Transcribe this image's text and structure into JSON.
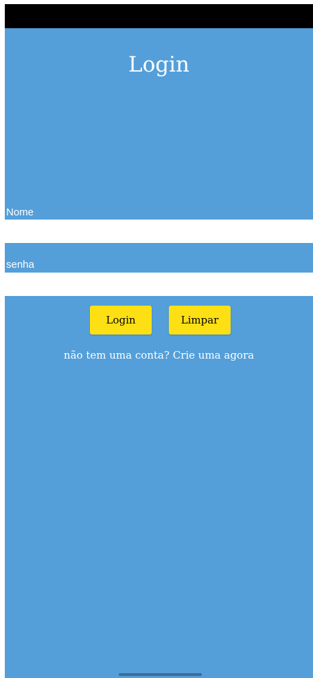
{
  "header": {
    "title": "Login"
  },
  "form": {
    "nome_label": "Nome",
    "nome_value": "",
    "senha_label": "senha",
    "senha_value": ""
  },
  "buttons": {
    "login_label": "Login",
    "limpar_label": "Limpar"
  },
  "signup": {
    "text": "não tem uma conta? Crie uma agora"
  },
  "colors": {
    "background": "#549fd9",
    "button": "#fde013",
    "status_bar": "#000000",
    "input": "#ffffff"
  }
}
